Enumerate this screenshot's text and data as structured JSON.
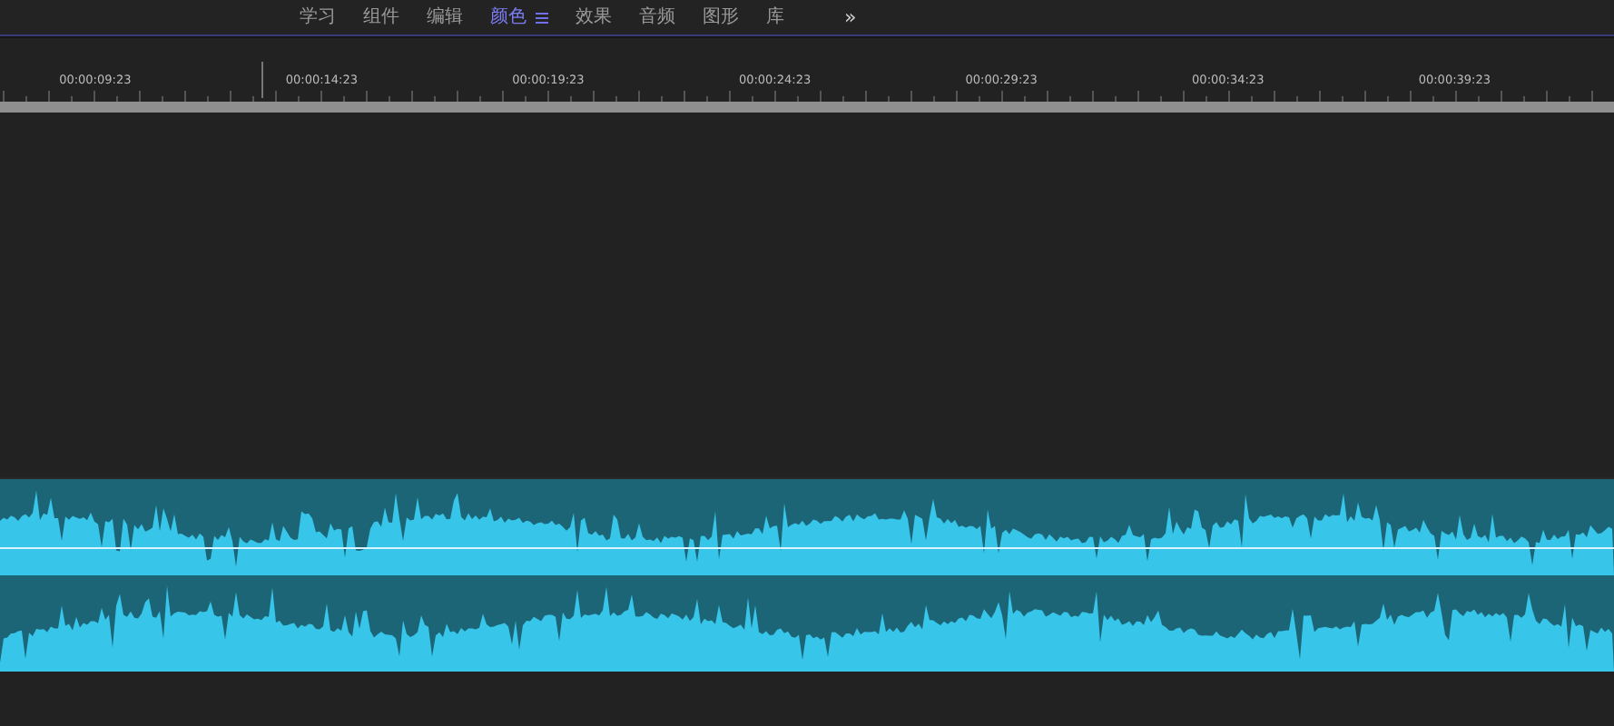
{
  "tabs": [
    {
      "label": "学习",
      "selected": false
    },
    {
      "label": "组件",
      "selected": false
    },
    {
      "label": "编辑",
      "selected": false
    },
    {
      "label": "颜色",
      "selected": true
    },
    {
      "label": "效果",
      "selected": false
    },
    {
      "label": "音频",
      "selected": false
    },
    {
      "label": "图形",
      "selected": false
    },
    {
      "label": "库",
      "selected": false
    }
  ],
  "overflow": "»",
  "ruler": {
    "timecodes": [
      "00:00:09:23",
      "00:00:14:23",
      "00:00:19:23",
      "00:00:24:23",
      "00:00:29:23",
      "00:00:34:23",
      "00:00:39:23"
    ]
  }
}
